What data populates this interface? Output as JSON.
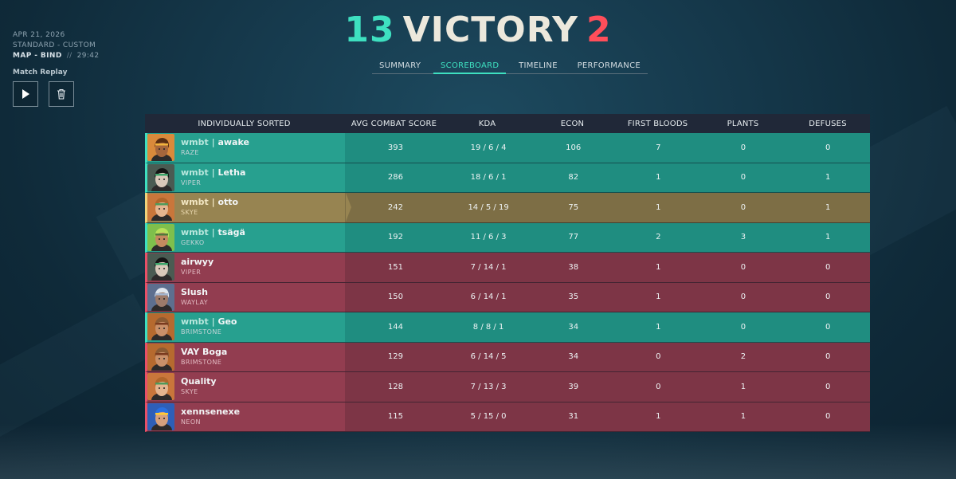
{
  "header": {
    "date": "APR 21, 2026",
    "mode": "STANDARD - CUSTOM",
    "map": "MAP - BIND",
    "separator": "//",
    "duration": "29:42",
    "replay_label": "Match Replay"
  },
  "score": {
    "team_score": "13",
    "result": "VICTORY",
    "enemy_score": "2"
  },
  "colors": {
    "team": "#3ee0c0",
    "enemy": "#ff4e5a",
    "self": "#978451"
  },
  "tabs": [
    {
      "label": "SUMMARY"
    },
    {
      "label": "SCOREBOARD",
      "active": true
    },
    {
      "label": "TIMELINE"
    },
    {
      "label": "PERFORMANCE"
    }
  ],
  "table": {
    "columns": [
      "INDIVIDUALLY SORTED",
      "AVG COMBAT SCORE",
      "KDA",
      "ECON",
      "FIRST BLOODS",
      "PLANTS",
      "DEFUSES"
    ],
    "rows": [
      {
        "tag": "wmbt | ",
        "name": "awake",
        "agent": "RAZE",
        "acs": "393",
        "kda": "19 / 6 / 4",
        "econ": "106",
        "fb": "7",
        "plants": "0",
        "defuses": "0",
        "team": "a",
        "avatar": "raze"
      },
      {
        "tag": "wmbt | ",
        "name": "Letha",
        "agent": "VIPER",
        "acs": "286",
        "kda": "18 / 6 / 1",
        "econ": "82",
        "fb": "1",
        "plants": "0",
        "defuses": "1",
        "team": "a",
        "avatar": "viper"
      },
      {
        "tag": "wmbt | ",
        "name": "otto",
        "agent": "SKYE",
        "acs": "242",
        "kda": "14 / 5 / 19",
        "econ": "75",
        "fb": "1",
        "plants": "0",
        "defuses": "1",
        "team": "self",
        "avatar": "skye"
      },
      {
        "tag": "wmbt | ",
        "name": "tsägä",
        "agent": "GEKKO",
        "acs": "192",
        "kda": "11 / 6 / 3",
        "econ": "77",
        "fb": "2",
        "plants": "3",
        "defuses": "1",
        "team": "a",
        "avatar": "gekko"
      },
      {
        "tag": "",
        "name": "airwyy",
        "agent": "VIPER",
        "acs": "151",
        "kda": "7 / 14 / 1",
        "econ": "38",
        "fb": "1",
        "plants": "0",
        "defuses": "0",
        "team": "b",
        "avatar": "viper"
      },
      {
        "tag": "",
        "name": "Slush",
        "agent": "WAYLAY",
        "acs": "150",
        "kda": "6 / 14 / 1",
        "econ": "35",
        "fb": "1",
        "plants": "0",
        "defuses": "0",
        "team": "b",
        "avatar": "waylay"
      },
      {
        "tag": "wmbt | ",
        "name": "Geo",
        "agent": "BRIMSTONE",
        "acs": "144",
        "kda": "8 / 8 / 1",
        "econ": "34",
        "fb": "1",
        "plants": "0",
        "defuses": "0",
        "team": "a",
        "avatar": "brimstone"
      },
      {
        "tag": "",
        "name": "VAY Boga",
        "agent": "BRIMSTONE",
        "acs": "129",
        "kda": "6 / 14 / 5",
        "econ": "34",
        "fb": "0",
        "plants": "2",
        "defuses": "0",
        "team": "b",
        "avatar": "brimstone"
      },
      {
        "tag": "",
        "name": "Quality",
        "agent": "SKYE",
        "acs": "128",
        "kda": "7 / 13 / 3",
        "econ": "39",
        "fb": "0",
        "plants": "1",
        "defuses": "0",
        "team": "b",
        "avatar": "skye"
      },
      {
        "tag": "",
        "name": "xennsenexe",
        "agent": "NEON",
        "acs": "115",
        "kda": "5 / 15 / 0",
        "econ": "31",
        "fb": "1",
        "plants": "1",
        "defuses": "0",
        "team": "b",
        "avatar": "neon"
      }
    ]
  }
}
